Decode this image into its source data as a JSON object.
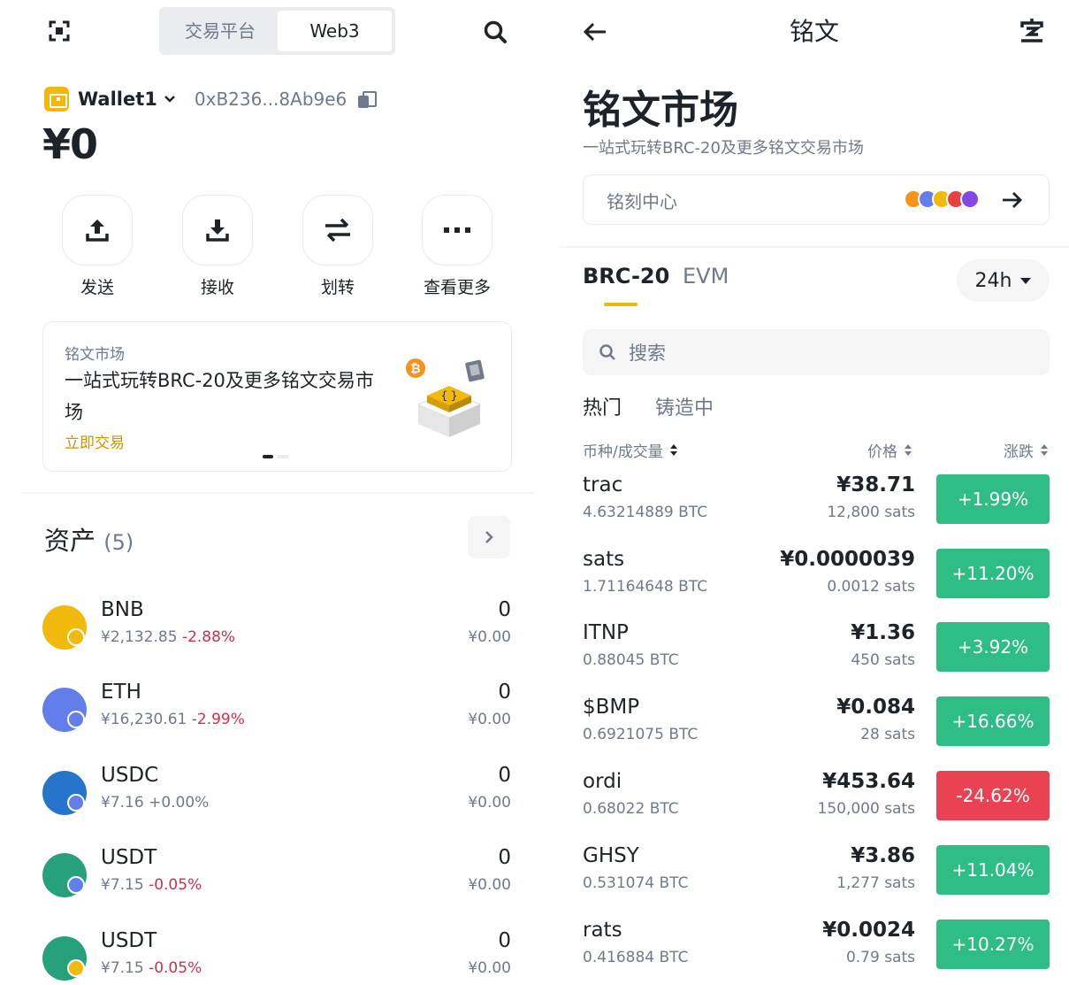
{
  "left": {
    "segment": {
      "exchange": "交易平台",
      "web3": "Web3"
    },
    "wallet": {
      "name": "Wallet1",
      "address": "0xB236...8Ab9e6",
      "balance": "¥0"
    },
    "actions": [
      {
        "label": "发送",
        "icon": "upload-icon"
      },
      {
        "label": "接收",
        "icon": "download-icon"
      },
      {
        "label": "划转",
        "icon": "transfer-icon"
      },
      {
        "label": "查看更多",
        "icon": "more-icon"
      }
    ],
    "banner": {
      "tag": "铭文市场",
      "title": "一站式玩转BRC-20及更多铭文交易市场",
      "cta": "立即交易"
    },
    "assets": {
      "title": "资产",
      "count": "(5)",
      "items": [
        {
          "name": "BNB",
          "price": "¥2,132.85",
          "change": "-2.88%",
          "amount": "0",
          "value": "¥0.00",
          "color": "#f0b90b",
          "badge": "#f0b90b",
          "negative": true
        },
        {
          "name": "ETH",
          "price": "¥16,230.61",
          "change": "-2.99%",
          "amount": "0",
          "value": "¥0.00",
          "color": "#627eea",
          "badge": "#627eea",
          "negative": true
        },
        {
          "name": "USDC",
          "price": "¥7.16",
          "change": "+0.00%",
          "amount": "0",
          "value": "¥0.00",
          "color": "#2775ca",
          "badge": "#627eea",
          "negative": false
        },
        {
          "name": "USDT",
          "price": "¥7.15",
          "change": "-0.05%",
          "amount": "0",
          "value": "¥0.00",
          "color": "#26a17b",
          "badge": "#627eea",
          "negative": true
        },
        {
          "name": "USDT",
          "price": "¥7.15",
          "change": "-0.05%",
          "amount": "0",
          "value": "¥0.00",
          "color": "#26a17b",
          "badge": "#f0b90b",
          "negative": true
        }
      ]
    }
  },
  "right": {
    "nav": {
      "title": "铭文"
    },
    "page": {
      "title": "铭文市场",
      "subtitle": "一站式玩转BRC-20及更多铭文交易市场"
    },
    "inscribe": {
      "label": "铭刻中心",
      "chains": [
        "#f7931a",
        "#627eea",
        "#f0b90b",
        "#e84142",
        "#8247e5"
      ]
    },
    "tabs": {
      "brc20": "BRC-20",
      "evm": "EVM"
    },
    "period": "24h",
    "search": {
      "placeholder": "搜索"
    },
    "subtabs": {
      "hot": "热门",
      "minting": "铸造中"
    },
    "headers": {
      "coin": "币种/成交量",
      "price": "价格",
      "change": "涨跌"
    },
    "tokens": [
      {
        "ticker": "trac",
        "volume": "4.63214889 BTC",
        "price": "¥38.71",
        "sats": "12,800 sats",
        "change": "+1.99%",
        "up": true
      },
      {
        "ticker": "sats",
        "volume": "1.71164648 BTC",
        "price": "¥0.0000039",
        "sats": "0.0012 sats",
        "change": "+11.20%",
        "up": true
      },
      {
        "ticker": "ITNP",
        "volume": "0.88045 BTC",
        "price": "¥1.36",
        "sats": "450 sats",
        "change": "+3.92%",
        "up": true
      },
      {
        "ticker": "$BMP",
        "volume": "0.6921075 BTC",
        "price": "¥0.084",
        "sats": "28 sats",
        "change": "+16.66%",
        "up": true
      },
      {
        "ticker": "ordi",
        "volume": "0.68022 BTC",
        "price": "¥453.64",
        "sats": "150,000 sats",
        "change": "-24.62%",
        "up": false
      },
      {
        "ticker": "GHSY",
        "volume": "0.531074 BTC",
        "price": "¥3.86",
        "sats": "1,277 sats",
        "change": "+11.04%",
        "up": true
      },
      {
        "ticker": "rats",
        "volume": "0.416884 BTC",
        "price": "¥0.0024",
        "sats": "0.79 sats",
        "change": "+10.27%",
        "up": true
      }
    ]
  }
}
